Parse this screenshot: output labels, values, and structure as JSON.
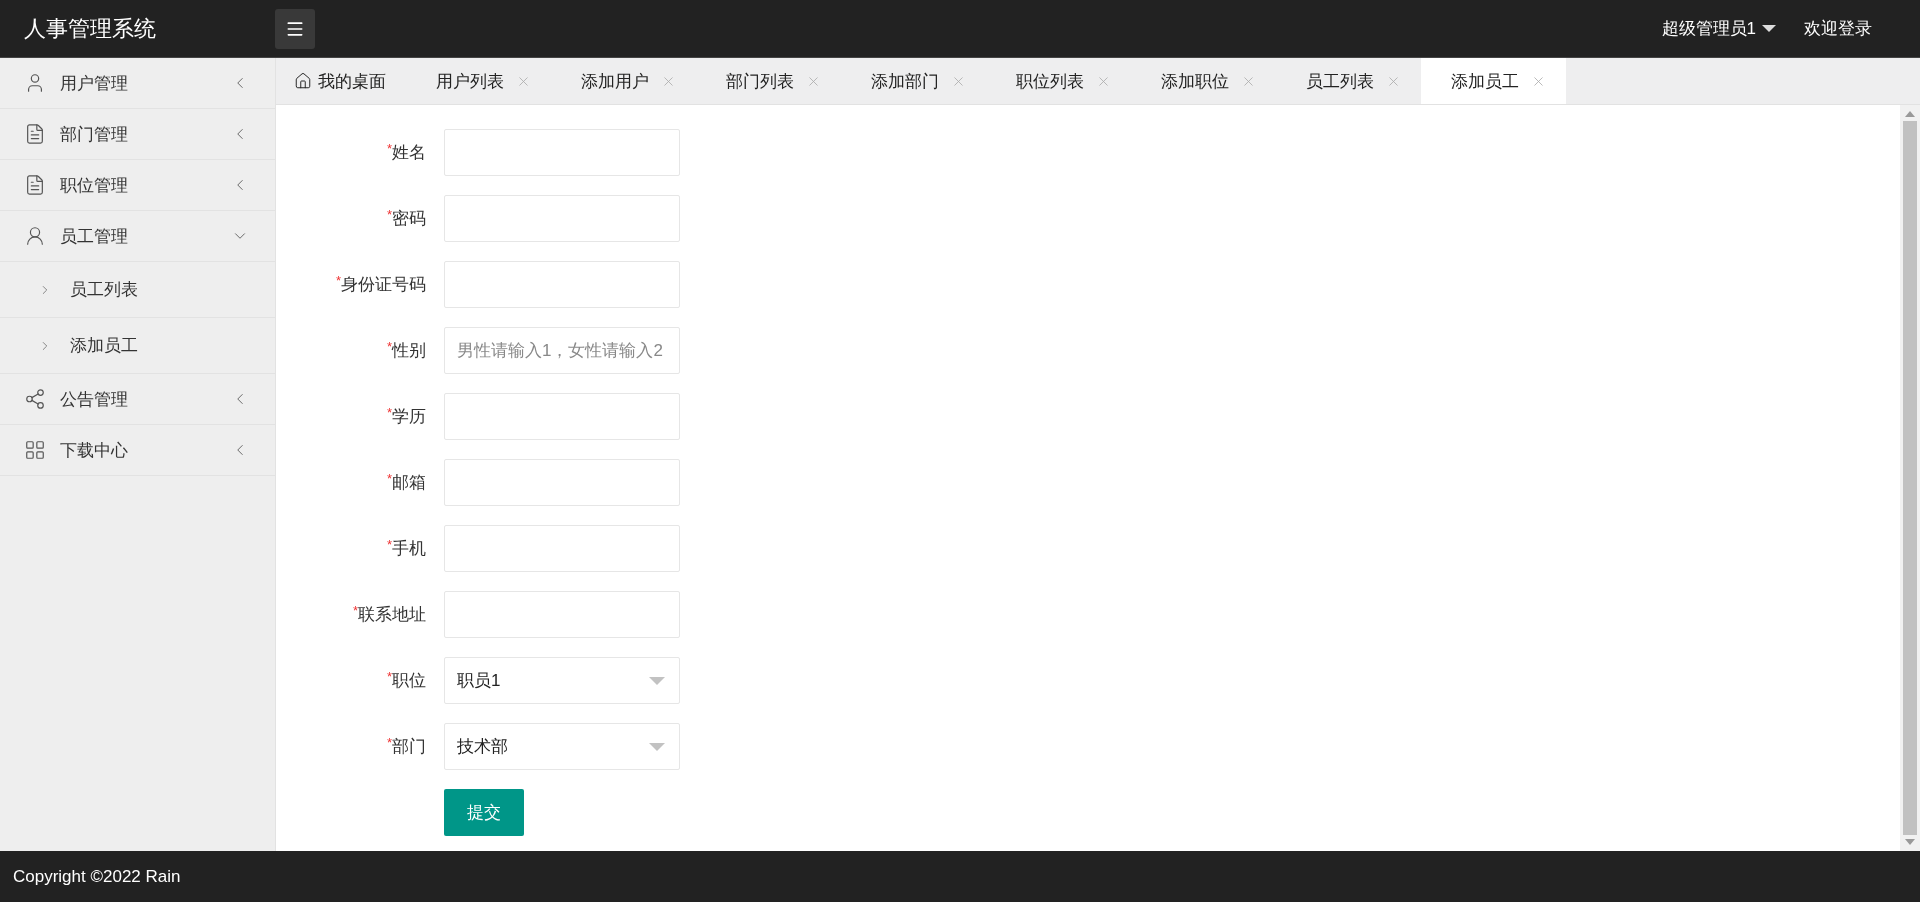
{
  "header": {
    "title": "人事管理系统",
    "user": "超级管理员1",
    "welcome": "欢迎登录"
  },
  "sidebar": {
    "items": [
      {
        "label": "用户管理",
        "expanded": false
      },
      {
        "label": "部门管理",
        "expanded": false
      },
      {
        "label": "职位管理",
        "expanded": false
      },
      {
        "label": "员工管理",
        "expanded": true,
        "children": [
          {
            "label": "员工列表"
          },
          {
            "label": "添加员工"
          }
        ]
      },
      {
        "label": "公告管理",
        "expanded": false
      },
      {
        "label": "下载中心",
        "expanded": false
      }
    ]
  },
  "tabs": [
    {
      "label": "我的桌面",
      "kind": "home",
      "selected": false
    },
    {
      "label": "用户列表",
      "kind": "page",
      "selected": false
    },
    {
      "label": "添加用户",
      "kind": "page",
      "selected": false
    },
    {
      "label": "部门列表",
      "kind": "page",
      "selected": false
    },
    {
      "label": "添加部门",
      "kind": "page",
      "selected": false
    },
    {
      "label": "职位列表",
      "kind": "page",
      "selected": false
    },
    {
      "label": "添加职位",
      "kind": "page",
      "selected": false
    },
    {
      "label": "员工列表",
      "kind": "page",
      "selected": false
    },
    {
      "label": "添加员工",
      "kind": "page",
      "selected": true
    }
  ],
  "form": {
    "fields": [
      {
        "mark": "*",
        "label": "姓名",
        "kind": "text"
      },
      {
        "mark": "*",
        "label": "密码",
        "kind": "text"
      },
      {
        "mark": "*",
        "label": "身份证号码",
        "kind": "text"
      },
      {
        "mark": "*",
        "label": "性别",
        "kind": "text",
        "placeholder": "男性请输入1，女性请输入2"
      },
      {
        "mark": "*",
        "label": "学历",
        "kind": "text"
      },
      {
        "mark": "*",
        "label": "邮箱",
        "kind": "text"
      },
      {
        "mark": "*",
        "label": "手机",
        "kind": "text"
      },
      {
        "mark": "*",
        "label": "联系地址",
        "kind": "text"
      },
      {
        "mark": "*",
        "label": "职位",
        "kind": "select",
        "value": "职员1"
      },
      {
        "mark": "*",
        "label": "部门",
        "kind": "select",
        "value": "技术部"
      }
    ],
    "submit": "提交"
  },
  "footer": "Copyright ©2022 Rain"
}
